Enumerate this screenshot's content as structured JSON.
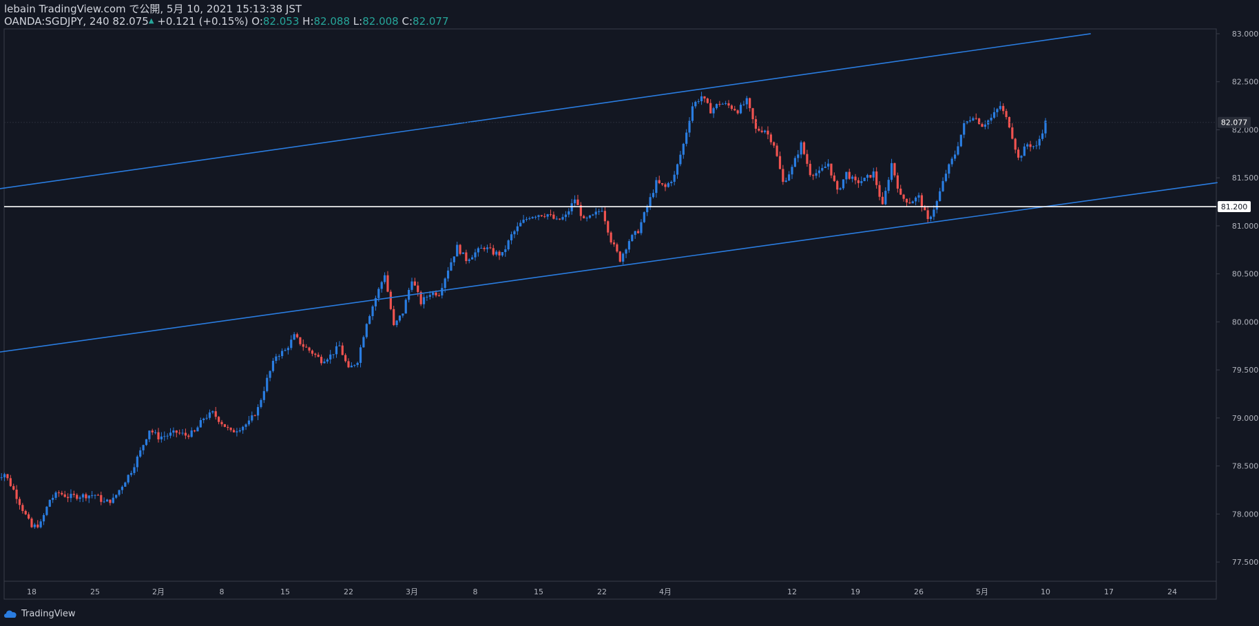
{
  "header": {
    "published": "lebain TradingView.com で公開, 5月 10, 2021 15:13:38 JST",
    "symbol": "OANDA:SGDJPY, 240",
    "last": "82.075",
    "change_arrow": "▲",
    "change": "+0.121 (+0.15%)",
    "o_label": "O:",
    "o": "82.053",
    "h_label": "H:",
    "h": "82.088",
    "l_label": "L:",
    "l": "82.008",
    "c_label": "C:",
    "c": "82.077"
  },
  "footer": {
    "brand": "TradingView",
    "icon": "tradingview-cloud-icon"
  },
  "colors": {
    "background": "#131722",
    "up": "#2a7de1",
    "down": "#ef5350",
    "trendline": "#2a7de1",
    "hline": "#ffffff",
    "axis_text": "#b2b5be",
    "border": "#3a3e4a"
  },
  "chart_data": {
    "type": "candlestick",
    "symbol": "OANDA:SGDJPY",
    "interval": "240",
    "ylim": [
      77.3,
      83.05
    ],
    "y_ticks": [
      "77.500",
      "78.000",
      "78.500",
      "79.000",
      "79.500",
      "80.000",
      "80.500",
      "81.000",
      "81.500",
      "82.000",
      "82.500",
      "83.000"
    ],
    "x_ticks": [
      {
        "label": "18",
        "date": "2021-01-18"
      },
      {
        "label": "25",
        "date": "2021-01-25"
      },
      {
        "label": "2月",
        "date": "2021-02-01"
      },
      {
        "label": "8",
        "date": "2021-02-08"
      },
      {
        "label": "15",
        "date": "2021-02-15"
      },
      {
        "label": "22",
        "date": "2021-02-22"
      },
      {
        "label": "3月",
        "date": "2021-03-01"
      },
      {
        "label": "8",
        "date": "2021-03-08"
      },
      {
        "label": "15",
        "date": "2021-03-15"
      },
      {
        "label": "22",
        "date": "2021-03-22"
      },
      {
        "label": "4月",
        "date": "2021-03-29"
      },
      {
        "label": "12",
        "date": "2021-04-12"
      },
      {
        "label": "19",
        "date": "2021-04-19"
      },
      {
        "label": "26",
        "date": "2021-04-26"
      },
      {
        "label": "5月",
        "date": "2021-05-03"
      },
      {
        "label": "10",
        "date": "2021-05-10"
      },
      {
        "label": "17",
        "date": "2021-05-17"
      },
      {
        "label": "24",
        "date": "2021-05-24"
      }
    ],
    "price_path": [
      [
        "2021-01-14",
        78.38
      ],
      [
        "2021-01-15",
        78.42
      ],
      [
        "2021-01-16",
        78.25
      ],
      [
        "2021-01-17",
        78.05
      ],
      [
        "2021-01-18",
        77.86
      ],
      [
        "2021-01-19",
        77.9
      ],
      [
        "2021-01-20",
        78.15
      ],
      [
        "2021-01-21",
        78.22
      ],
      [
        "2021-01-22",
        78.18
      ],
      [
        "2021-01-25",
        78.2
      ],
      [
        "2021-01-26",
        78.12
      ],
      [
        "2021-01-27",
        78.15
      ],
      [
        "2021-01-28",
        78.3
      ],
      [
        "2021-01-29",
        78.45
      ],
      [
        "2021-01-30",
        78.65
      ],
      [
        "2021-01-31",
        78.88
      ],
      [
        "2021-02-01",
        78.8
      ],
      [
        "2021-02-02",
        78.82
      ],
      [
        "2021-02-03",
        78.85
      ],
      [
        "2021-02-04",
        78.82
      ],
      [
        "2021-02-05",
        78.85
      ],
      [
        "2021-02-06",
        79.0
      ],
      [
        "2021-02-07",
        79.05
      ],
      [
        "2021-02-08",
        78.95
      ],
      [
        "2021-02-09",
        78.85
      ],
      [
        "2021-02-10",
        78.9
      ],
      [
        "2021-02-11",
        78.95
      ],
      [
        "2021-02-12",
        79.1
      ],
      [
        "2021-02-13",
        79.4
      ],
      [
        "2021-02-14",
        79.65
      ],
      [
        "2021-02-15",
        79.7
      ],
      [
        "2021-02-16",
        79.85
      ],
      [
        "2021-02-17",
        79.75
      ],
      [
        "2021-02-18",
        79.68
      ],
      [
        "2021-02-19",
        79.6
      ],
      [
        "2021-02-20",
        79.65
      ],
      [
        "2021-02-21",
        79.75
      ],
      [
        "2021-02-22",
        79.5
      ],
      [
        "2021-02-23",
        79.6
      ],
      [
        "2021-02-24",
        80.0
      ],
      [
        "2021-02-25",
        80.25
      ],
      [
        "2021-02-26",
        80.5
      ],
      [
        "2021-02-27",
        79.95
      ],
      [
        "2021-02-28",
        80.1
      ],
      [
        "2021-03-01",
        80.45
      ],
      [
        "2021-03-02",
        80.2
      ],
      [
        "2021-03-03",
        80.3
      ],
      [
        "2021-03-04",
        80.3
      ],
      [
        "2021-03-05",
        80.55
      ],
      [
        "2021-03-06",
        80.78
      ],
      [
        "2021-03-07",
        80.65
      ],
      [
        "2021-03-08",
        80.72
      ],
      [
        "2021-03-09",
        80.78
      ],
      [
        "2021-03-10",
        80.72
      ],
      [
        "2021-03-11",
        80.7
      ],
      [
        "2021-03-12",
        80.9
      ],
      [
        "2021-03-13",
        81.02
      ],
      [
        "2021-03-14",
        81.1
      ],
      [
        "2021-03-15",
        81.12
      ],
      [
        "2021-03-16",
        81.12
      ],
      [
        "2021-03-17",
        81.05
      ],
      [
        "2021-03-18",
        81.1
      ],
      [
        "2021-03-19",
        81.28
      ],
      [
        "2021-03-20",
        81.05
      ],
      [
        "2021-03-21",
        81.1
      ],
      [
        "2021-03-22",
        81.18
      ],
      [
        "2021-03-23",
        80.85
      ],
      [
        "2021-03-24",
        80.65
      ],
      [
        "2021-03-25",
        80.85
      ],
      [
        "2021-03-26",
        80.95
      ],
      [
        "2021-03-27",
        81.2
      ],
      [
        "2021-03-28",
        81.45
      ],
      [
        "2021-03-29",
        81.4
      ],
      [
        "2021-03-30",
        81.52
      ],
      [
        "2021-03-31",
        81.85
      ],
      [
        "2021-04-01",
        82.25
      ],
      [
        "2021-04-02",
        82.35
      ],
      [
        "2021-04-03",
        82.2
      ],
      [
        "2021-04-04",
        82.28
      ],
      [
        "2021-04-05",
        82.25
      ],
      [
        "2021-04-06",
        82.2
      ],
      [
        "2021-04-07",
        82.3
      ],
      [
        "2021-04-08",
        82.0
      ],
      [
        "2021-04-09",
        82.0
      ],
      [
        "2021-04-10",
        81.85
      ],
      [
        "2021-04-11",
        81.45
      ],
      [
        "2021-04-12",
        81.6
      ],
      [
        "2021-04-13",
        81.85
      ],
      [
        "2021-04-14",
        81.55
      ],
      [
        "2021-04-15",
        81.55
      ],
      [
        "2021-04-16",
        81.65
      ],
      [
        "2021-04-17",
        81.35
      ],
      [
        "2021-04-18",
        81.55
      ],
      [
        "2021-04-19",
        81.45
      ],
      [
        "2021-04-20",
        81.48
      ],
      [
        "2021-04-21",
        81.55
      ],
      [
        "2021-04-22",
        81.2
      ],
      [
        "2021-04-23",
        81.65
      ],
      [
        "2021-04-24",
        81.3
      ],
      [
        "2021-04-25",
        81.25
      ],
      [
        "2021-04-26",
        81.3
      ],
      [
        "2021-04-27",
        81.05
      ],
      [
        "2021-04-28",
        81.25
      ],
      [
        "2021-04-29",
        81.55
      ],
      [
        "2021-04-30",
        81.75
      ],
      [
        "2021-05-01",
        82.05
      ],
      [
        "2021-05-02",
        82.15
      ],
      [
        "2021-05-03",
        82.05
      ],
      [
        "2021-05-04",
        82.12
      ],
      [
        "2021-05-05",
        82.25
      ],
      [
        "2021-05-06",
        82.05
      ],
      [
        "2021-05-07",
        81.7
      ],
      [
        "2021-05-08",
        81.85
      ],
      [
        "2021-05-09",
        81.82
      ],
      [
        "2021-05-10",
        82.077
      ]
    ],
    "trendlines": [
      {
        "name": "upper-channel",
        "from": [
          "2021-01-14",
          81.38
        ],
        "to": [
          "2021-05-15",
          83.0
        ]
      },
      {
        "name": "lower-channel",
        "from": [
          "2021-01-14",
          79.68
        ],
        "to": [
          "2021-05-29",
          81.45
        ]
      }
    ],
    "hlines": [
      {
        "name": "support",
        "value": 81.2,
        "label": "81.200"
      }
    ],
    "last_price": {
      "value": 82.077,
      "label": "82.077"
    },
    "grid": false
  }
}
